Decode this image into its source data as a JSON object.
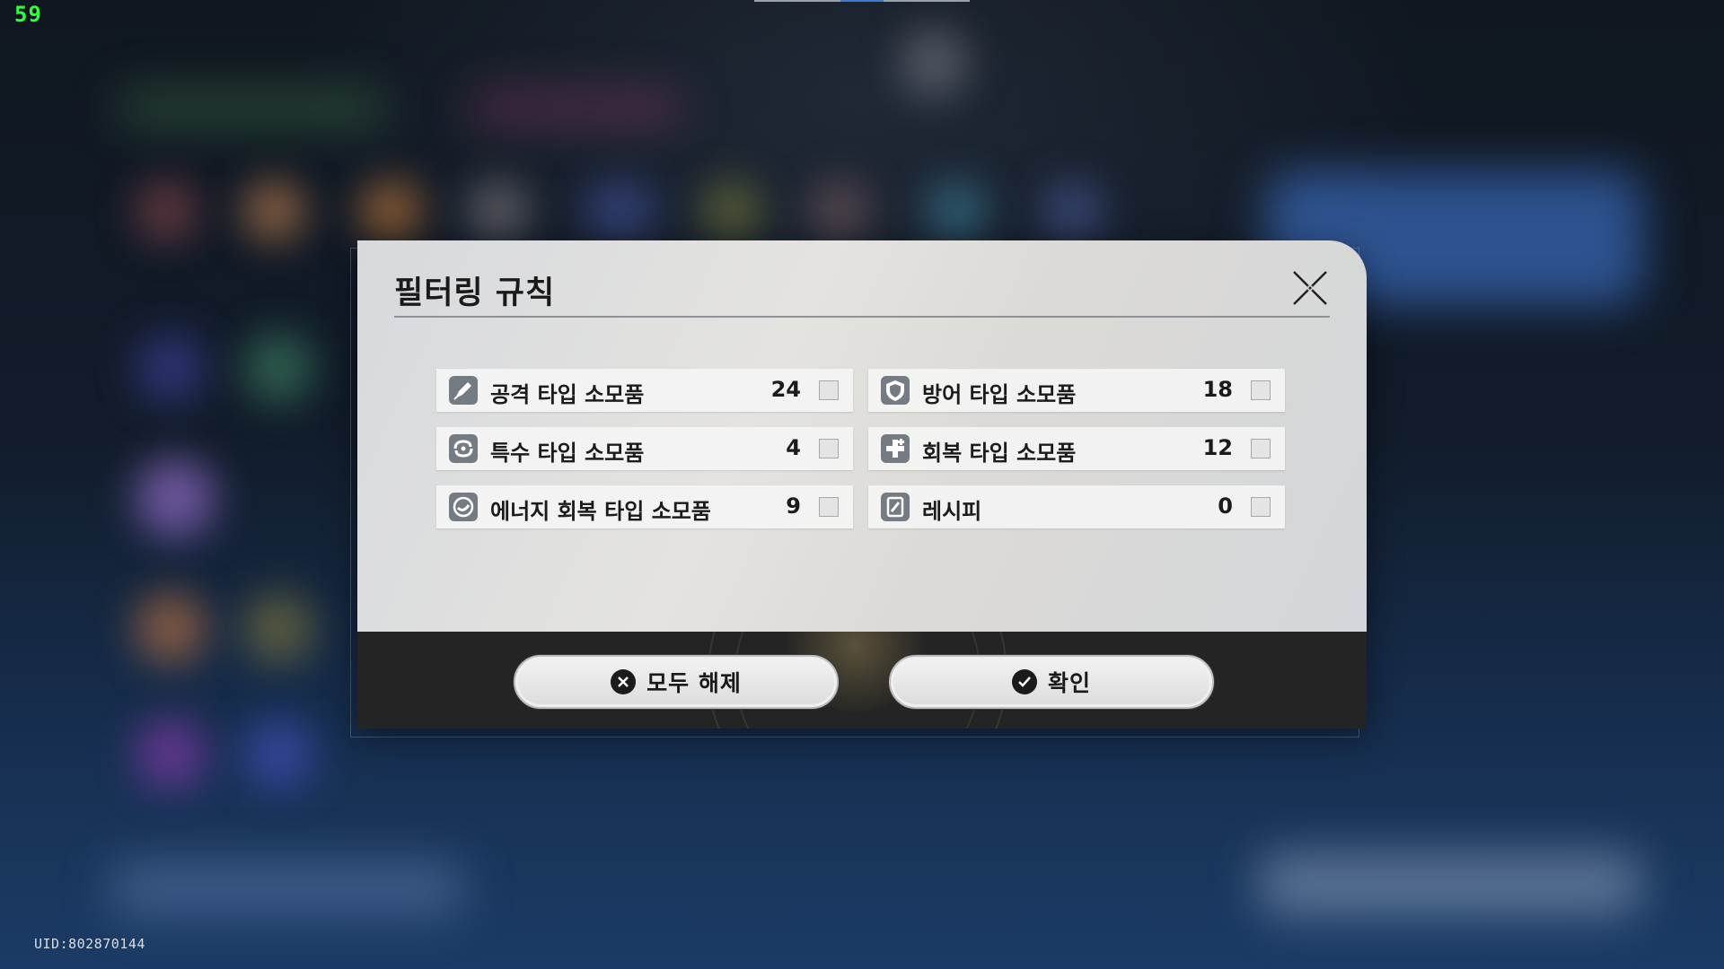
{
  "hud": {
    "fps_counter": "59",
    "uid": "UID:802870144"
  },
  "dialog": {
    "title": "필터링 규칙",
    "close_icon": "close-x-icon",
    "filters": [
      {
        "label": "공격 타입 소모품",
        "count": "24",
        "icon": "sword-icon",
        "checked": false
      },
      {
        "label": "방어 타입 소모품",
        "count": "18",
        "icon": "shield-icon",
        "checked": false
      },
      {
        "label": "특수 타입 소모품",
        "count": "4",
        "icon": "swirl-icon",
        "checked": false
      },
      {
        "label": "회복 타입 소모품",
        "count": "12",
        "icon": "plus-heal-icon",
        "checked": false
      },
      {
        "label": "에너지 회복 타입 소모품",
        "count": "9",
        "icon": "energy-icon",
        "checked": false
      },
      {
        "label": "레시피",
        "count": "0",
        "icon": "recipe-icon",
        "checked": false
      }
    ],
    "buttons": {
      "clear_all": "모두 해제",
      "confirm": "확인"
    }
  },
  "colors": {
    "fps": "#2dff3c",
    "dialog_bg": "#dcdcdc",
    "footer_bg": "#242424",
    "icon_bg": "#747b82"
  }
}
